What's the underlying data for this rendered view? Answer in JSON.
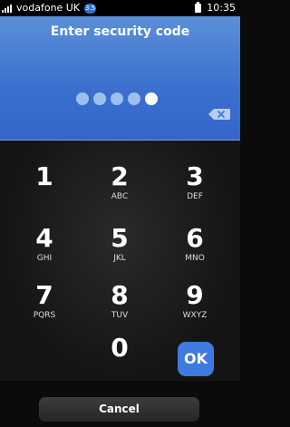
{
  "status_bar": {
    "carrier": "vodafone UK",
    "network_badge": "3.5",
    "time": "10:35"
  },
  "header": {
    "title": "Enter security code",
    "pin_length": 5,
    "active_dot_index": 4
  },
  "keypad": {
    "keys": [
      {
        "digit": "1",
        "letters": ""
      },
      {
        "digit": "2",
        "letters": "ABC"
      },
      {
        "digit": "3",
        "letters": "DEF"
      },
      {
        "digit": "4",
        "letters": "GHI"
      },
      {
        "digit": "5",
        "letters": "JKL"
      },
      {
        "digit": "6",
        "letters": "MNO"
      },
      {
        "digit": "7",
        "letters": "PQRS"
      },
      {
        "digit": "8",
        "letters": "TUV"
      },
      {
        "digit": "9",
        "letters": "WXYZ"
      },
      {
        "digit": "0",
        "letters": ""
      }
    ],
    "ok_label": "OK"
  },
  "footer": {
    "cancel_label": "Cancel"
  },
  "colors": {
    "header_blue": "#3a6fcf",
    "ok_blue": "#3e7ae0"
  },
  "icons": {
    "backspace": "backspace-icon",
    "signal": "signal-icon",
    "battery": "battery-icon"
  }
}
